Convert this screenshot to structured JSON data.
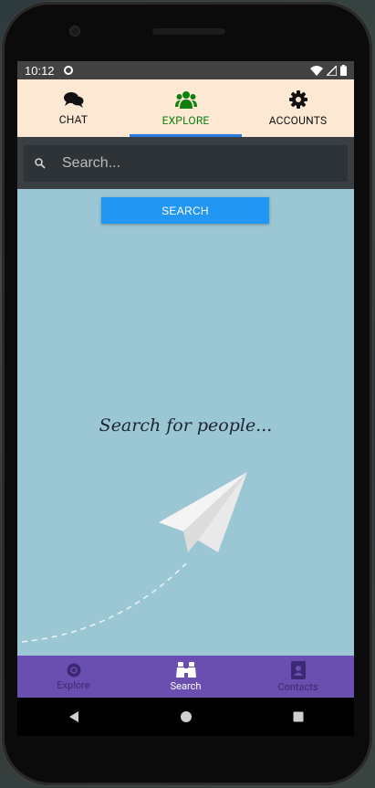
{
  "status": {
    "time": "10:12"
  },
  "top_tabs": [
    {
      "label": "CHAT",
      "icon": "chat-bubbles-icon"
    },
    {
      "label": "EXPLORE",
      "icon": "group-icon"
    },
    {
      "label": "ACCOUNTS",
      "icon": "gear-icon"
    }
  ],
  "search": {
    "placeholder": "Search...",
    "button_label": "SEARCH"
  },
  "empty_state": {
    "message": "Search for people..."
  },
  "bottom_tabs": [
    {
      "label": "Explore",
      "icon": "explore-icon"
    },
    {
      "label": "Search",
      "icon": "binoculars-icon"
    },
    {
      "label": "Contacts",
      "icon": "contacts-book-icon"
    }
  ],
  "colors": {
    "top_bar": "#fde9d3",
    "active_tab_text": "#0c7f0c",
    "active_tab_indicator": "#2d7be0",
    "search_bar": "#3a3f44",
    "button": "#2196f3",
    "content_bg": "#9bc6d4",
    "bottom_bar": "#6a4fb0"
  }
}
